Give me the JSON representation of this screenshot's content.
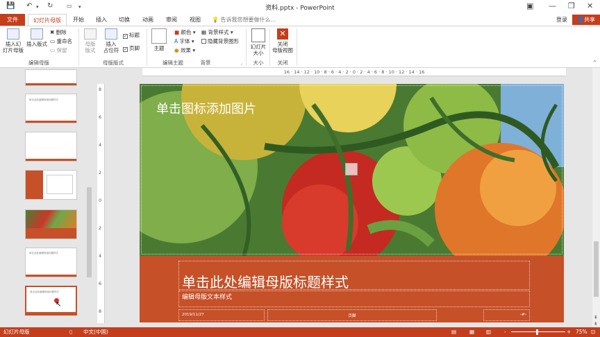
{
  "window": {
    "title": "资料.pptx - PowerPoint"
  },
  "tabs": [
    {
      "label": "文件"
    },
    {
      "label": "幻灯片母版"
    },
    {
      "label": "开始"
    },
    {
      "label": "插入"
    },
    {
      "label": "切换"
    },
    {
      "label": "动画"
    },
    {
      "label": "审阅"
    },
    {
      "label": "视图"
    }
  ],
  "tellme": "告诉我您想要做什么...",
  "signin": "登录",
  "share": "共享",
  "ribbon": {
    "insert_master": "插入幻\n灯片母版",
    "insert_layout": "插入版式",
    "delete": "删除",
    "rename": "重命名",
    "preserve": "保留",
    "group_edit_master": "编辑母版",
    "master_layout": "母版\n版式",
    "insert_placeholder": "插入\n占位符",
    "title_chk": "标题",
    "footer_chk": "页脚",
    "group_master_layout": "母版版式",
    "theme": "主题",
    "group_edit_theme": "编辑主题",
    "colors": "颜色",
    "fonts": "字体",
    "effects": "效果",
    "bg_styles": "背景样式",
    "hide_bg": "隐藏背景图形",
    "group_background": "背景",
    "slide_size": "幻灯片\n大小",
    "group_size": "大小",
    "close_view": "关闭\n母版视图",
    "group_close": "关闭"
  },
  "ruler_h": "16 · 14 · 12 · 10 · 8 · 6 · 4 · 2 · 0 · 2 · 4 · 6 · 8 · 10 · 12 · 14 · 16",
  "ruler_v": [
    "8",
    "6",
    "4",
    "2",
    "0",
    "2",
    "4",
    "6",
    "8"
  ],
  "slide": {
    "picture_prompt": "单击图标添加图片",
    "title": "单击此处编辑母版标题样式",
    "subtitle": "编辑母版文本样式",
    "date": "2019/11/27",
    "footer": "页脚",
    "page_num": "‹#›"
  },
  "thumbs": {
    "t3": "单击此处编辑母版标题样式",
    "t4": "单击此处编辑母版标题样式",
    "t5": "单击此处编辑母版标题样式"
  },
  "status": {
    "view": "幻灯片母版",
    "lang": "中文(中国)",
    "zoom": "75%",
    "minus": "-",
    "plus": "+"
  },
  "colors": {
    "accent": "#c43e1c",
    "band": "#c65028"
  }
}
